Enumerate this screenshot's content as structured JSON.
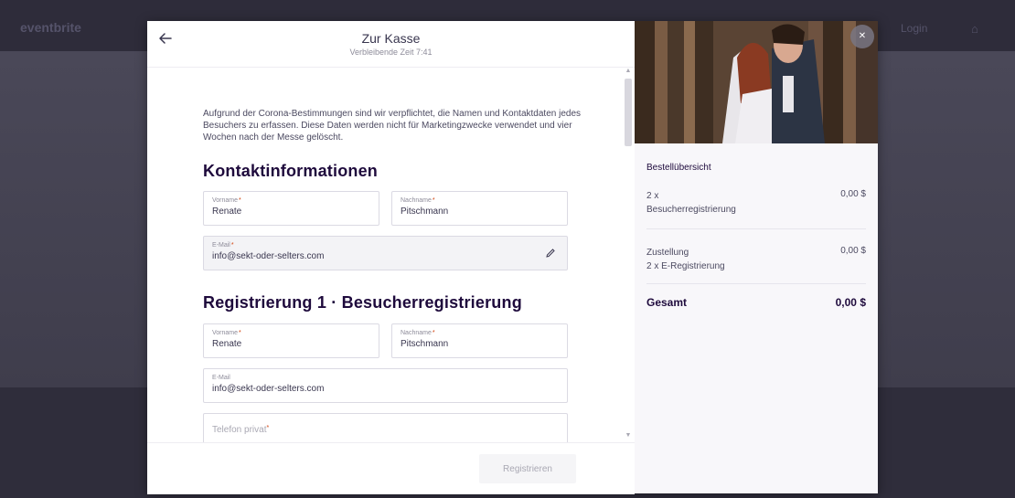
{
  "backdrop": {
    "logo": "eventbrite",
    "link_right": "Login"
  },
  "header": {
    "title": "Zur Kasse",
    "subtitle": "Verbleibende Zeit 7:41"
  },
  "intro_text": "Aufgrund der Corona-Bestimmungen sind wir verpflichtet, die Namen und Kontaktdaten jedes Besuchers zu erfassen. Diese Daten werden nicht für Marketingzwecke verwendet und vier Wochen nach der Messe gelöscht.",
  "contact": {
    "title": "Kontaktinformationen",
    "first_name_label": "Vorname",
    "first_name_value": "Renate",
    "last_name_label": "Nachname",
    "last_name_value": "Pitschmann",
    "email_label": "E-Mail",
    "email_value": "info@sekt-oder-selters.com"
  },
  "registration": {
    "title": "Registrierung 1 · Besucherregistrierung",
    "first_name_label": "Vorname",
    "first_name_value": "Renate",
    "last_name_label": "Nachname",
    "last_name_value": "Pitschmann",
    "email_label": "E-Mail",
    "email_value": "info@sekt-oder-selters.com",
    "phone_placeholder": "Telefon privat"
  },
  "footer": {
    "register_label": "Registrieren"
  },
  "summary": {
    "title": "Bestellübersicht",
    "items": [
      {
        "line1": "2 x",
        "line2": "Besucherregistrierung",
        "price": "0,00 $"
      },
      {
        "line1": "Zustellung",
        "line2": "2 x E-Registrierung",
        "price": "0,00 $"
      }
    ],
    "total_label": "Gesamt",
    "total_value": "0,00 $"
  },
  "colors": {
    "accent": "#d1410c",
    "heading": "#1e0a3c",
    "text": "#39364f"
  }
}
